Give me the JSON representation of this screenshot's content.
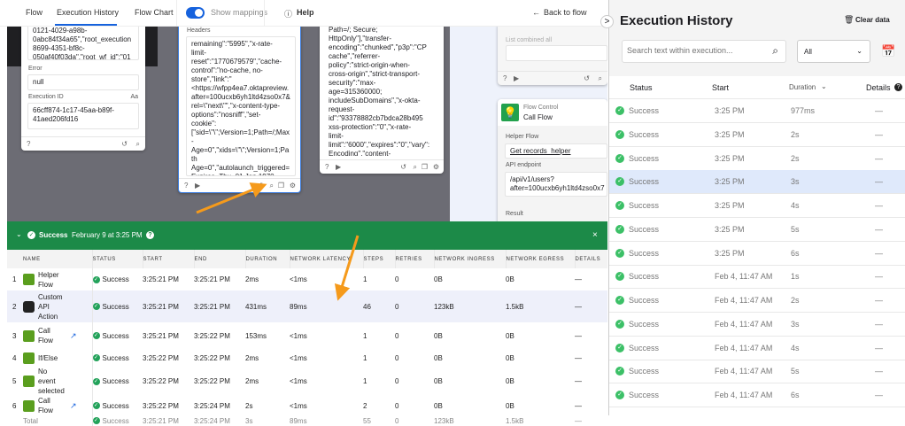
{
  "nav": {
    "tabs": [
      "Flow",
      "Execution History",
      "Flow Chart"
    ],
    "active_tab": "Execution History",
    "toggle_label": "Show mappings",
    "toggle_on": true,
    "help": "Help",
    "back": "Back to flow"
  },
  "canvas": {
    "card1": {
      "top_text": "0121-4029-a98b-\n0abc84f34a65\",\"root_execution\n8699-4351-bf8c-\n050af40f03da\",\"root_wf_id\":\"01",
      "error_label": "Error",
      "error_value": "null",
      "exec_label": "Execution ID",
      "exec_type": "Aa",
      "exec_value": "66cff874-1c17-45aa-b89f-\n41aed206fd16"
    },
    "card2": {
      "label": "Headers",
      "text": "remaining\":\"5995\",\"x-rate-\nlimit-\nreset\":\"1770679579\",\"cache-\ncontrol\":\"no-cache, no-\nstore\",\"link\":\"\n<https://wfpp4ea7.oktapreview.\nafter=100ucxb6yh1ltd4zso0x7&\nrel=\\\"next\\\"\",\"x-content-type-\noptions\":\"nosniff\",\"set-\ncookie\":\n[\"sid=\\\"\\\";Version=1;Path=/;Max-\nAge=0\",\"xids=\\\"\\\";Version=1;Path\nAge=0\",\"autolaunch_triggered=\nExpires=Thu, 01 Jan 1970\n00:00:10 GMT;\nPath=/\",\"activate_ca_modal_trig"
    },
    "card3": {
      "text": "Path=/; Secure;\nHttpOnly\"],\"transfer-\nencoding\":\"chunked\",\"p3p\":\"CP\ncache\",\"referrer-\npolicy\":\"strict-origin-when-\ncross-origin\",\"strict-transport-\nsecurity\":\"max-\nage=315360000;\nincludeSubDomains\",\"x-okta-\nrequest-\nid\":\"93378882cb7bdca28b495\nxss-protection\":\"0\",\"x-rate-\nlimit-\nlimit\":\"6000\",\"expires\":\"0\",\"vary\":\nEncoding\",\"content-\ntype\":\"application/json\",\"date\":\""
    },
    "card4": {
      "label": "List combined all"
    },
    "card5": {
      "category": "Flow Control",
      "title": "Call Flow",
      "helper_label": "Helper Flow",
      "helper_value": "Get records_helper",
      "api_label": "API endpoint",
      "api_value": "/api/v1/users?\nafter=100ucxb6yh1ltd4zso0x7",
      "result_label": "Result"
    }
  },
  "banner": {
    "status": "Success",
    "date": "February 9 at 3:25 PM",
    "close": "×"
  },
  "steps": {
    "columns": [
      "",
      "NAME",
      "STATUS",
      "START",
      "END",
      "DURATION",
      "NETWORK LATENCY",
      "STEPS",
      "RETRIES",
      "NETWORK INGRESS",
      "NETWORK EGRESS",
      "DETAILS"
    ],
    "rows": [
      {
        "n": "1",
        "name": "Helper Flow",
        "status": "Success",
        "start": "3:25:21 PM",
        "end": "3:25:21 PM",
        "duration": "2ms",
        "latency": "<1ms",
        "steps": "1",
        "retries": "0",
        "ingress": "0B",
        "egress": "0B",
        "details": "—",
        "icon": "flow-icon",
        "link": false
      },
      {
        "n": "2",
        "name": "Custom API Action",
        "status": "Success",
        "start": "3:25:21 PM",
        "end": "3:25:21 PM",
        "duration": "431ms",
        "latency": "89ms",
        "steps": "46",
        "retries": "0",
        "ingress": "123kB",
        "egress": "1.5kB",
        "details": "—",
        "icon": "api-icon",
        "link": false
      },
      {
        "n": "3",
        "name": "Call Flow",
        "status": "Success",
        "start": "3:25:21 PM",
        "end": "3:25:22 PM",
        "duration": "153ms",
        "latency": "<1ms",
        "steps": "1",
        "retries": "0",
        "ingress": "0B",
        "egress": "0B",
        "details": "—",
        "icon": "flow-icon",
        "link": true
      },
      {
        "n": "4",
        "name": "If/Else",
        "status": "Success",
        "start": "3:25:22 PM",
        "end": "3:25:22 PM",
        "duration": "2ms",
        "latency": "<1ms",
        "steps": "1",
        "retries": "0",
        "ingress": "0B",
        "egress": "0B",
        "details": "—",
        "icon": "flow-icon",
        "link": false
      },
      {
        "n": "5",
        "name": "No event selected",
        "status": "Success",
        "start": "3:25:22 PM",
        "end": "3:25:22 PM",
        "duration": "2ms",
        "latency": "<1ms",
        "steps": "1",
        "retries": "0",
        "ingress": "0B",
        "egress": "0B",
        "details": "—",
        "icon": "flow-icon",
        "link": false
      },
      {
        "n": "6",
        "name": "Call Flow",
        "status": "Success",
        "start": "3:25:22 PM",
        "end": "3:25:24 PM",
        "duration": "2s",
        "latency": "<1ms",
        "steps": "2",
        "retries": "0",
        "ingress": "0B",
        "egress": "0B",
        "details": "—",
        "icon": "flow-icon",
        "link": true
      }
    ],
    "total": {
      "n": "",
      "name": "Total",
      "status": "Success",
      "start": "3:25:21 PM",
      "end": "3:25:24 PM",
      "duration": "3s",
      "latency": "89ms",
      "steps": "55",
      "retries": "0",
      "ingress": "123kB",
      "egress": "1.5kB",
      "details": "—"
    }
  },
  "history": {
    "title": "Execution History",
    "clear": "Clear data",
    "search_placeholder": "Search text within execution...",
    "filter": "All",
    "columns": {
      "status": "Status",
      "start": "Start",
      "duration": "Duration",
      "details": "Details"
    },
    "rows": [
      {
        "status": "Success",
        "start": "3:25 PM",
        "duration": "977ms",
        "details": "—"
      },
      {
        "status": "Success",
        "start": "3:25 PM",
        "duration": "2s",
        "details": "—"
      },
      {
        "status": "Success",
        "start": "3:25 PM",
        "duration": "2s",
        "details": "—"
      },
      {
        "status": "Success",
        "start": "3:25 PM",
        "duration": "3s",
        "details": "—",
        "selected": true
      },
      {
        "status": "Success",
        "start": "3:25 PM",
        "duration": "4s",
        "details": "—"
      },
      {
        "status": "Success",
        "start": "3:25 PM",
        "duration": "5s",
        "details": "—"
      },
      {
        "status": "Success",
        "start": "3:25 PM",
        "duration": "6s",
        "details": "—"
      },
      {
        "status": "Success",
        "start": "Feb 4, 11:47 AM",
        "duration": "1s",
        "details": "—"
      },
      {
        "status": "Success",
        "start": "Feb 4, 11:47 AM",
        "duration": "2s",
        "details": "—"
      },
      {
        "status": "Success",
        "start": "Feb 4, 11:47 AM",
        "duration": "3s",
        "details": "—"
      },
      {
        "status": "Success",
        "start": "Feb 4, 11:47 AM",
        "duration": "4s",
        "details": "—"
      },
      {
        "status": "Success",
        "start": "Feb 4, 11:47 AM",
        "duration": "5s",
        "details": "—"
      },
      {
        "status": "Success",
        "start": "Feb 4, 11:47 AM",
        "duration": "6s",
        "details": "—"
      }
    ]
  },
  "colors": {
    "success": "#1c8a48",
    "accent": "#1662dd",
    "annotation": "#f59a1b"
  }
}
